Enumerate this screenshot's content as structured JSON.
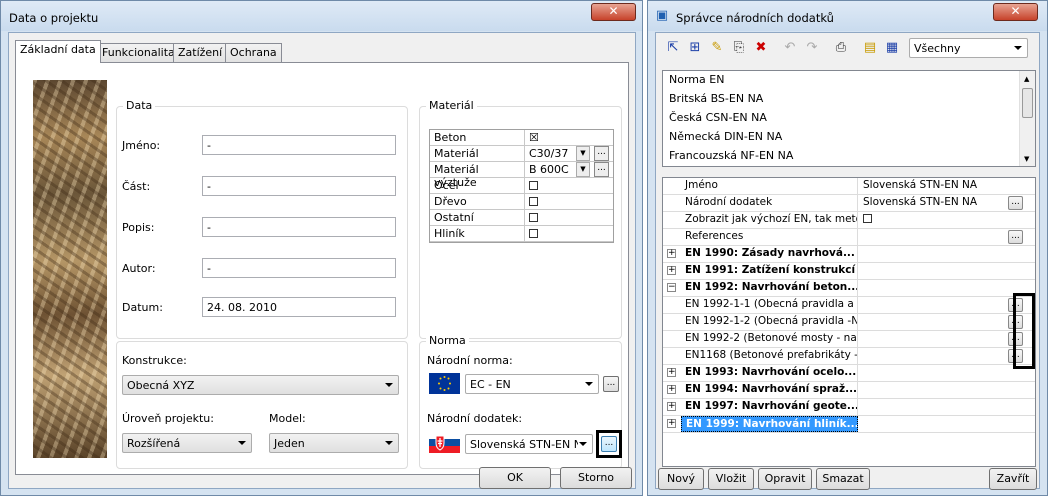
{
  "dialog1": {
    "title": "Data o projektu",
    "tabs": [
      "Základní data",
      "Funkcionalita",
      "Zatížení",
      "Ochrana"
    ],
    "data_group": {
      "title": "Data",
      "fields": [
        {
          "label": "Jméno:",
          "value": "-"
        },
        {
          "label": "Část:",
          "value": "-"
        },
        {
          "label": "Popis:",
          "value": "-"
        },
        {
          "label": "Autor:",
          "value": "-"
        },
        {
          "label": "Datum:",
          "value": "24. 08. 2010"
        }
      ]
    },
    "konstrukce": {
      "label": "Konstrukce:",
      "value": "Obecná XYZ"
    },
    "uroven": {
      "label": "Úroveň projektu:",
      "value": "Rozšířená"
    },
    "model": {
      "label": "Model:",
      "value": "Jeden"
    },
    "material_group": {
      "title": "Materiál",
      "rows": [
        {
          "name": "Beton",
          "value": "☒",
          "kind": "checked"
        },
        {
          "name": "Materiál",
          "value": "C30/37",
          "kind": "combo"
        },
        {
          "name": "Materiál výztuže",
          "value": "B 600C",
          "kind": "combo"
        },
        {
          "name": "Ocel",
          "value": "",
          "kind": "check"
        },
        {
          "name": "Dřevo",
          "value": "",
          "kind": "check"
        },
        {
          "name": "Ostatní",
          "value": "",
          "kind": "check"
        },
        {
          "name": "Hliník",
          "value": "",
          "kind": "check"
        }
      ]
    },
    "norma_group": {
      "title": "Norma",
      "narodni_norma_label": "Národní norma:",
      "narodni_norma_value": "EC - EN",
      "narodni_dodatek_label": "Národní dodatek:",
      "narodni_dodatek_value": "Slovenská STN-EN NA"
    },
    "ok_label": "OK",
    "storno_label": "Storno",
    "dots": "..."
  },
  "dialog2": {
    "title": "Správce národních dodatků",
    "filter_value": "Všechny",
    "list": [
      "Norma EN",
      "Britská BS-EN NA",
      "Česká CSN-EN NA",
      "Německá DIN-EN NA",
      "Francouzská NF-EN NA"
    ],
    "grid": [
      {
        "name": "Jméno",
        "value": "Slovenská STN-EN NA",
        "expander": "",
        "bold": false,
        "dots": false
      },
      {
        "name": "Národní dodatek",
        "value": "Slovenská STN-EN NA",
        "expander": "",
        "bold": false,
        "dots": true
      },
      {
        "name": "Zobrazit jak výchozí EN, tak meto...",
        "value": "",
        "expander": "",
        "bold": false,
        "dots": false,
        "check": true
      },
      {
        "name": "References",
        "value": "",
        "expander": "",
        "bold": false,
        "dots": true
      },
      {
        "name": "EN 1990: Zásady navrhová...",
        "value": "",
        "expander": "+",
        "bold": true,
        "dots": false
      },
      {
        "name": "EN 1991: Zatížení konstrukcí",
        "value": "",
        "expander": "+",
        "bold": true,
        "dots": false
      },
      {
        "name": "EN 1992: Navrhování beton...",
        "value": "",
        "expander": "−",
        "bold": true,
        "dots": false
      },
      {
        "name": "EN 1992-1-1 (Obecná pravidla a p...",
        "value": "",
        "expander": "",
        "bold": false,
        "dots": true
      },
      {
        "name": "EN 1992-1-2 (Obecná pravidla -Na...",
        "value": "",
        "expander": "",
        "bold": false,
        "dots": true
      },
      {
        "name": "EN 1992-2 (Betonové mosty - navr...",
        "value": "",
        "expander": "",
        "bold": false,
        "dots": true
      },
      {
        "name": "EN1168 (Betonové prefabrikáty - d...",
        "value": "",
        "expander": "",
        "bold": false,
        "dots": true
      },
      {
        "name": "EN 1993: Navrhování ocelo...",
        "value": "",
        "expander": "+",
        "bold": true,
        "dots": false
      },
      {
        "name": "EN 1994: Navrhování spraž...",
        "value": "",
        "expander": "+",
        "bold": true,
        "dots": false
      },
      {
        "name": "EN 1997: Navrhování geote...",
        "value": "",
        "expander": "+",
        "bold": true,
        "dots": false
      },
      {
        "name": "EN 1999: Navrhování hliník...",
        "value": "",
        "expander": "+",
        "bold": true,
        "dots": false,
        "selected": true
      }
    ],
    "buttons": {
      "novy": "Nový",
      "vlozit": "Vložit",
      "opravit": "Opravit",
      "smazat": "Smazat",
      "zavrit": "Zavřít"
    }
  },
  "colors": {
    "highlight": "#3399ff",
    "title_bar": "#d5e3f1",
    "close_red": "#c7422a"
  }
}
